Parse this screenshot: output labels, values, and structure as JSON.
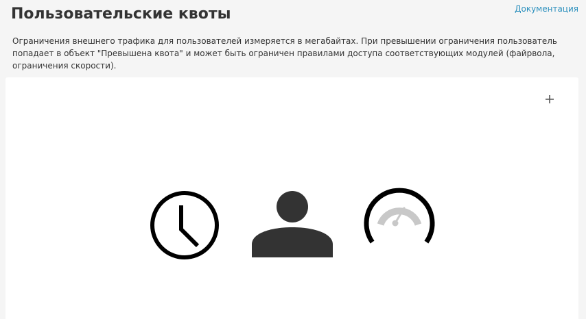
{
  "header": {
    "title": "Пользовательские квоты",
    "doc_link": "Документация"
  },
  "description": "Ограничения внешнего трафика для пользователей измеряется в мегабайтах. При превышении ограничения пользователь попадает в объект \"Превышена квота\" и может быть ограничен правилами доступа соответствующих модулей (файрвола, ограничения скорости).",
  "panel": {
    "add_button_icon": "plus-icon",
    "illustration_icons": [
      "clock-icon",
      "user-icon",
      "speedometer-icon"
    ]
  },
  "colors": {
    "page_background": "#f5f5f5",
    "panel_background": "#ffffff",
    "link": "#2a8fbd",
    "text": "#333333",
    "icon_dark": "#000000",
    "icon_user": "#333333",
    "gauge_light": "#c8c8c8"
  }
}
